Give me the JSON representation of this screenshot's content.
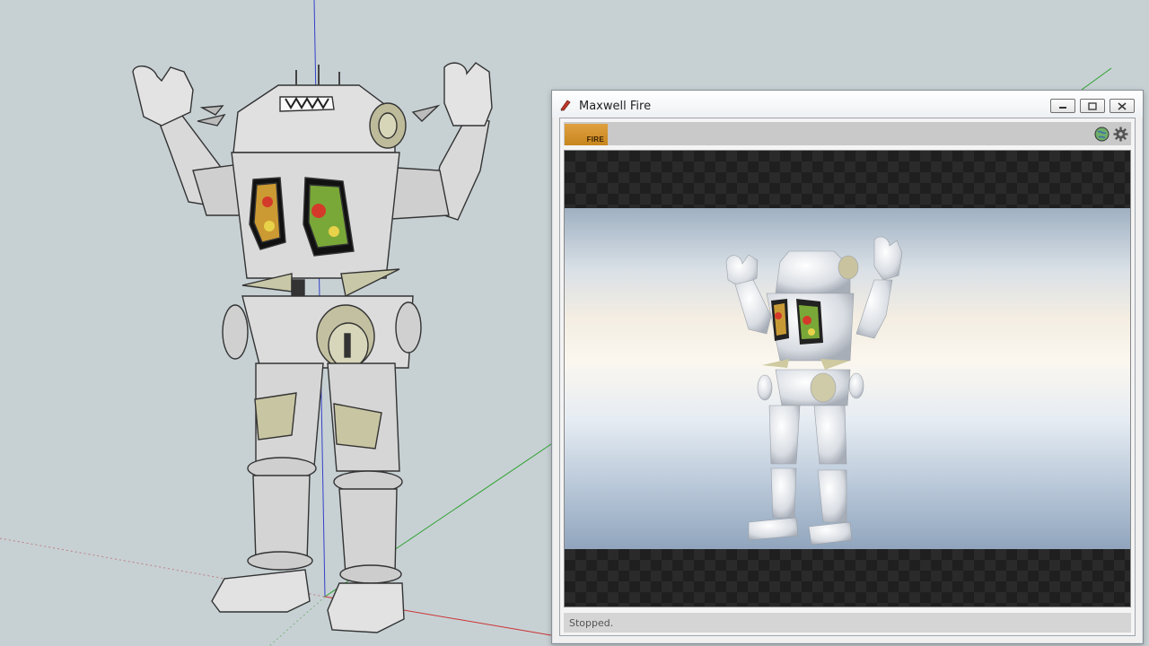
{
  "window": {
    "title": "Maxwell Fire",
    "app_icon": "maxwell-app-icon",
    "controls": [
      "minimize-icon",
      "maximize-icon",
      "close-icon"
    ]
  },
  "toolbar": {
    "fire_label": "FIRE",
    "icons": [
      "environment-globe-icon",
      "settings-gear-icon"
    ],
    "fire_color": "#d69532"
  },
  "status": {
    "text": "Stopped."
  },
  "viewport": {
    "background": "#c7d1d4",
    "axis_colors": {
      "red": "#cc3333",
      "green": "#2fa02f",
      "blue": "#3340c8"
    },
    "model": "robot-figure-model"
  }
}
